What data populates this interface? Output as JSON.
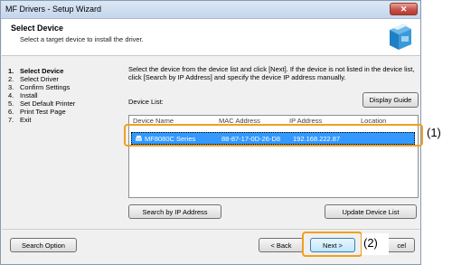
{
  "window": {
    "title": "MF Drivers - Setup Wizard",
    "close_glyph": "✕"
  },
  "header": {
    "title": "Select Device",
    "subtitle": "Select a target device to install the driver."
  },
  "steps": [
    {
      "num": "1.",
      "label": "Select Device",
      "active": true
    },
    {
      "num": "2.",
      "label": "Select Driver"
    },
    {
      "num": "3.",
      "label": "Confirm Settings"
    },
    {
      "num": "4.",
      "label": "Install"
    },
    {
      "num": "5.",
      "label": "Set Default Printer"
    },
    {
      "num": "6.",
      "label": "Print Test Page"
    },
    {
      "num": "7.",
      "label": "Exit"
    }
  ],
  "description": "Select the device from the device list and click [Next]. If the device is not listed in the device list, click [Search by IP Address] and specify the device IP address manually.",
  "device_list": {
    "label": "Device List:",
    "columns": [
      "Device Name",
      "MAC Address",
      "IP Address",
      "Location"
    ],
    "rows": [
      {
        "name": "MF8080C Series",
        "mac": "88-87-17-0D-26-D8",
        "ip": "192.168.222.87",
        "location": ""
      }
    ]
  },
  "buttons": {
    "display_guide": "Display Guide",
    "search_ip": "Search by IP Address",
    "update_list": "Update Device List",
    "search_option": "Search Option",
    "back": "< Back",
    "next": "Next >",
    "cancel": "Cancel",
    "cancel_visible": "cel"
  },
  "callouts": {
    "one": "(1)",
    "two": "(2)"
  },
  "colors": {
    "accent": "#3399ff",
    "highlight": "#f0a020"
  }
}
